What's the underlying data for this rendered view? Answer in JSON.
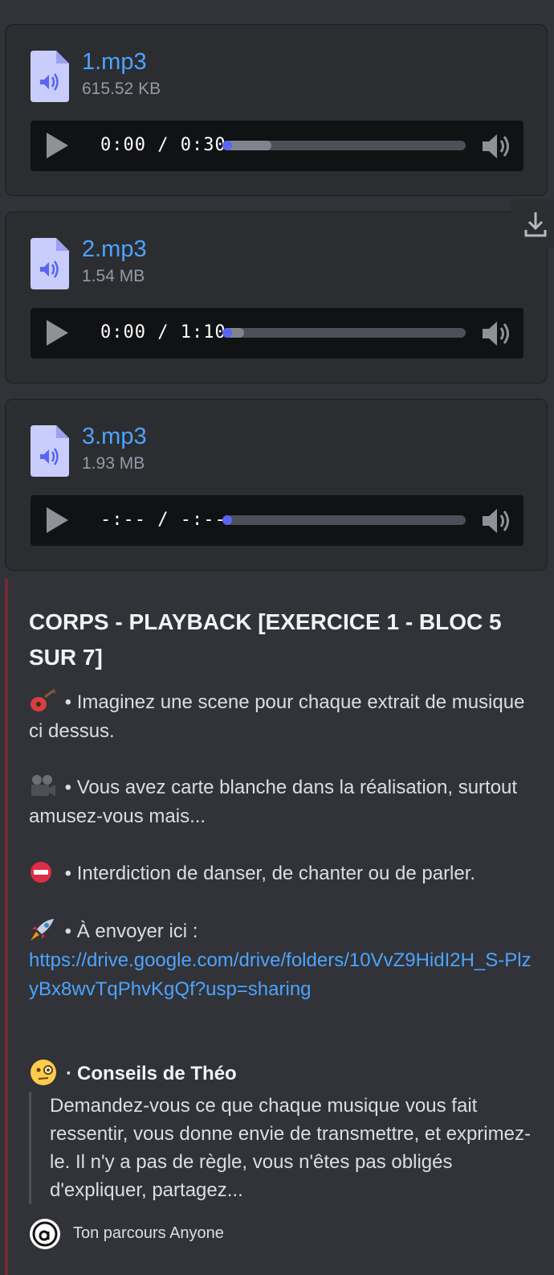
{
  "attachments": [
    {
      "name": "1.mp3",
      "size": "615.52 KB",
      "time": "0:00 / 0:30",
      "progress": 0.2
    },
    {
      "name": "2.mp3",
      "size": "1.54 MB",
      "time": "0:00 / 1:10",
      "progress": 0.09
    },
    {
      "name": "3.mp3",
      "size": "1.93 MB",
      "time": "-:-- / -:--",
      "progress": 0.0
    }
  ],
  "icons": {
    "file": "audio-file-icon",
    "play": "play-icon",
    "volume": "volume-icon",
    "download": "download-icon"
  },
  "colors": {
    "link": "#4da3ff",
    "embed_accent": "#6e2b33",
    "progress_knob": "#5865f2",
    "file_icon": "#c9cdfb"
  },
  "embed": {
    "title": "CORPS - PLAYBACK [EXERCICE 1 - BLOC 5 SUR 7]",
    "lines": [
      {
        "emoji": "guitar",
        "text": " • Imaginez une scene pour chaque extrait de musique ci dessus."
      },
      {
        "emoji": "movie-camera",
        "text": " • Vous avez carte blanche dans la réalisation, surtout amusez-vous mais..."
      },
      {
        "emoji": "no-entry",
        "text": " • Interdiction de danser, de chanter ou de parler."
      },
      {
        "emoji": "rocket",
        "text": " • À envoyer ici :"
      }
    ],
    "link": "https://drive.google.com/drive/folders/10VvZ9HidI2H_S-PlzyBx8wvTqPhvKgQf?usp=sharing",
    "quote_title": "Conseils de Théo",
    "quote_separator": "·",
    "quote_text": "Demandez-vous ce que chaque musique vous fait ressentir, vous donne envie de transmettre, et exprimez-le. Il n'y a pas de règle, vous n'êtes pas obligés d'expliquer, partagez...",
    "footer": "Ton parcours Anyone"
  }
}
